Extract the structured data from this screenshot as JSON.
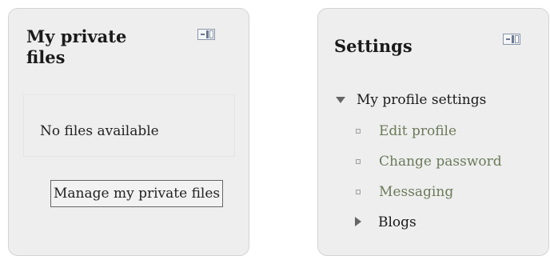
{
  "private_files": {
    "title": "My private files",
    "empty_text": "No files available",
    "manage_button_label": "Manage my private files"
  },
  "settings": {
    "title": "Settings",
    "tree": {
      "profile_settings_label": "My profile settings",
      "items": [
        {
          "label": "Edit profile",
          "icon": "bullet-icon"
        },
        {
          "label": "Change password",
          "icon": "bullet-icon"
        },
        {
          "label": "Messaging",
          "icon": "bullet-icon"
        }
      ],
      "blogs_label": "Blogs"
    }
  },
  "icons": {
    "dock": "dock-block-icon",
    "expanded": "triangle-down-icon",
    "collapsed": "triangle-right-icon"
  },
  "colors": {
    "block_background": "#eeeeee",
    "link": "#6a7a5a",
    "text": "#1a1a1a"
  }
}
